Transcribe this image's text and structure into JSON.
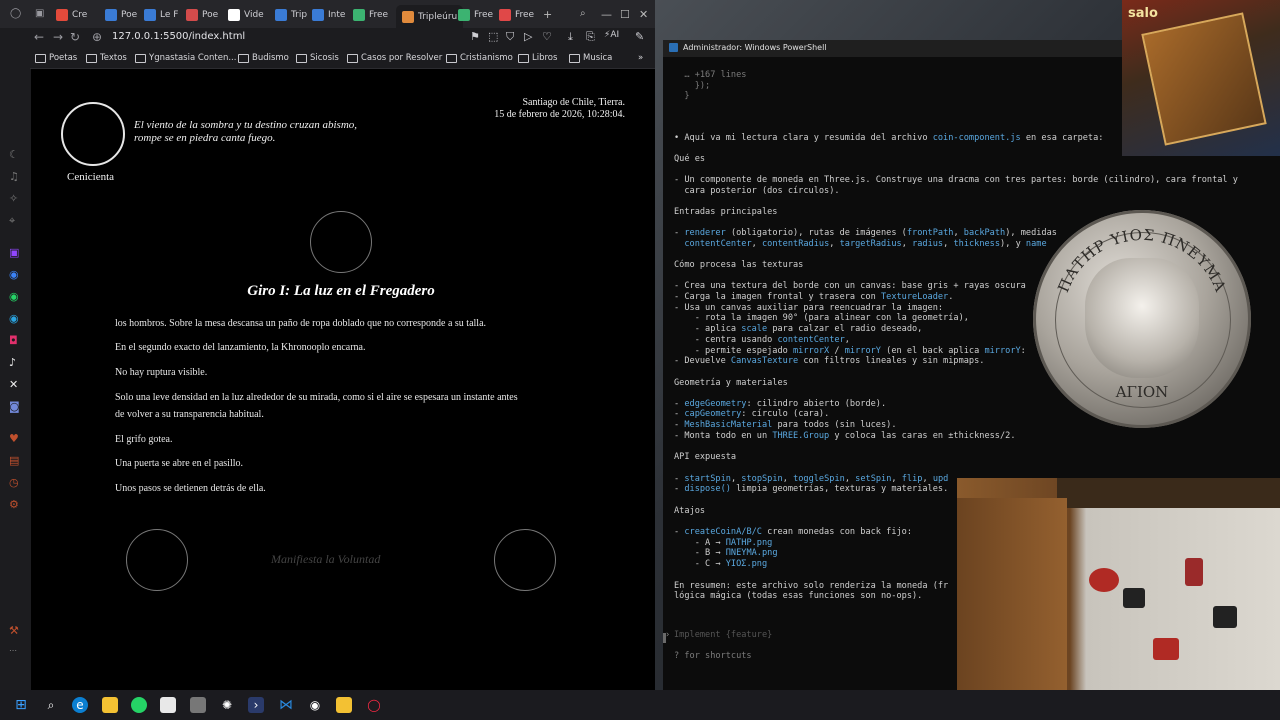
{
  "browser": {
    "tabs": [
      {
        "label": "Cre",
        "color": "#e24a3b"
      },
      {
        "label": "Poe",
        "color": "#3a7bd5"
      },
      {
        "label": "Le F",
        "color": "#3a7bd5"
      },
      {
        "label": "Poe",
        "color": "#d24b4b"
      },
      {
        "label": "Vide",
        "color": "#ffffff"
      },
      {
        "label": "Trip",
        "color": "#3a7bd5"
      },
      {
        "label": "Inte",
        "color": "#3a7bd5"
      },
      {
        "label": "Free",
        "color": "#3cb371"
      },
      {
        "label": "Tripleúru",
        "color": "#e08a3c",
        "active": true
      },
      {
        "label": "Free",
        "color": "#3cb371"
      },
      {
        "label": "Free",
        "color": "#e04848"
      }
    ],
    "url": "127.0.0.1:5500/index.html",
    "bookmarks": [
      "Poetas",
      "Textos",
      "Ygnastasia Conten...",
      "Budismo",
      "Sicosis",
      "Casos por Resolver",
      "Cristianismo",
      "Libros",
      "Musica"
    ]
  },
  "page": {
    "quote_line1": "El viento de la sombra y tu destino cruzan abismo,",
    "quote_line2": "rompe se en piedra canta fuego.",
    "place": "Santiago de Chile, Tierra.",
    "date": "15 de febrero de 2026, 10:28:04.",
    "character": "Cenicienta",
    "chapter_title": "Giro I: La luz en el Fregadero",
    "paragraphs": [
      "los hombros. Sobre la mesa descansa un paño de ropa doblado que no corresponde a su talla.",
      "En el segundo exacto del lanzamiento, la Khronooplo encarna.",
      "No hay ruptura visible.",
      "Solo una leve densidad en la luz alrededor de su mirada, como si el aire se espesara un instante antes",
      "de volver a su transparencia habitual.",
      "El grifo gotea.",
      "Una puerta se abre en el pasillo.",
      "Unos pasos se detienen detrás de ella."
    ],
    "manifest": "Manifiesta la Voluntad"
  },
  "powershell": {
    "title": "Administrador: Windows PowerShell",
    "lines": [
      {
        "t": "  … +167 lines",
        "c": "dim"
      },
      {
        "t": "    });",
        "c": "dim"
      },
      {
        "t": "  }",
        "c": "dim"
      },
      {
        "t": "• Aquí va mi lectura clara y resumida del archivo coin-component.js en esa carpeta:",
        "c": ""
      },
      {
        "t": "Qué es",
        "c": ""
      },
      {
        "t": "- Un componente de moneda en Three.js. Construye una dracma con tres partes: borde (cilindro), cara frontal y",
        "c": ""
      },
      {
        "t": "  cara posterior (dos círculos).",
        "c": ""
      },
      {
        "t": "Entradas principales",
        "c": ""
      },
      {
        "t": "- renderer (obligatorio), rutas de imágenes (frontPath, backPath), medidas",
        "c": ""
      },
      {
        "t": "  contentCenter, contentRadius, targetRadius, radius, thickness), y name",
        "c": ""
      },
      {
        "t": "Cómo procesa las texturas",
        "c": ""
      },
      {
        "t": "- Crea una textura del borde con un canvas: base gris + rayas oscura",
        "c": ""
      },
      {
        "t": "- Carga la imagen frontal y trasera con TextureLoader.",
        "c": ""
      },
      {
        "t": "- Usa un canvas auxiliar para reencuadrar la imagen:",
        "c": ""
      },
      {
        "t": "    - rota la imagen 90° (para alinear con la geometría),",
        "c": ""
      },
      {
        "t": "    - aplica scale para calzar el radio deseado,",
        "c": ""
      },
      {
        "t": "    - centra usando contentCenter,",
        "c": ""
      },
      {
        "t": "    - permite espejado mirrorX / mirrorY (en el back aplica mirrorY:",
        "c": ""
      },
      {
        "t": "- Devuelve CanvasTexture con filtros lineales y sin mipmaps.",
        "c": ""
      },
      {
        "t": "Geometría y materiales",
        "c": ""
      },
      {
        "t": "- edgeGeometry: cilindro abierto (borde).",
        "c": ""
      },
      {
        "t": "- capGeometry: círculo (cara).",
        "c": ""
      },
      {
        "t": "- MeshBasicMaterial para todos (sin luces).",
        "c": ""
      },
      {
        "t": "- Monta todo en un THREE.Group y coloca las caras en ±thickness/2.",
        "c": ""
      },
      {
        "t": "API expuesta",
        "c": ""
      },
      {
        "t": "- startSpin, stopSpin, toggleSpin, setSpin, flip, upd",
        "c": ""
      },
      {
        "t": "- dispose() limpia geometrías, texturas y materiales.",
        "c": ""
      },
      {
        "t": "Atajos",
        "c": ""
      },
      {
        "t": "- createCoinA/B/C crean monedas con back fijo:",
        "c": ""
      },
      {
        "t": "    - A → ΠΑΤΗΡ.png",
        "c": ""
      },
      {
        "t": "    - B → ΠΝΕΥΜΑ.png",
        "c": ""
      },
      {
        "t": "    - C → ΥΙΟΣ.png",
        "c": ""
      },
      {
        "t": "En resumen: este archivo solo renderiza la moneda (fr",
        "c": ""
      },
      {
        "t": "lógica mágica (todas esas funciones son no-ops).",
        "c": ""
      }
    ],
    "prompt_placeholder": "Implement {feature}",
    "shortcuts_hint": "? for shortcuts"
  },
  "overlays": {
    "coin_top_text": "ΠΑΤΗΡ ΥΙΟΣ ΠΝΕΥΜΑ",
    "coin_bottom_text": "ΑΓΙΟΝ",
    "book_label": "salo"
  }
}
